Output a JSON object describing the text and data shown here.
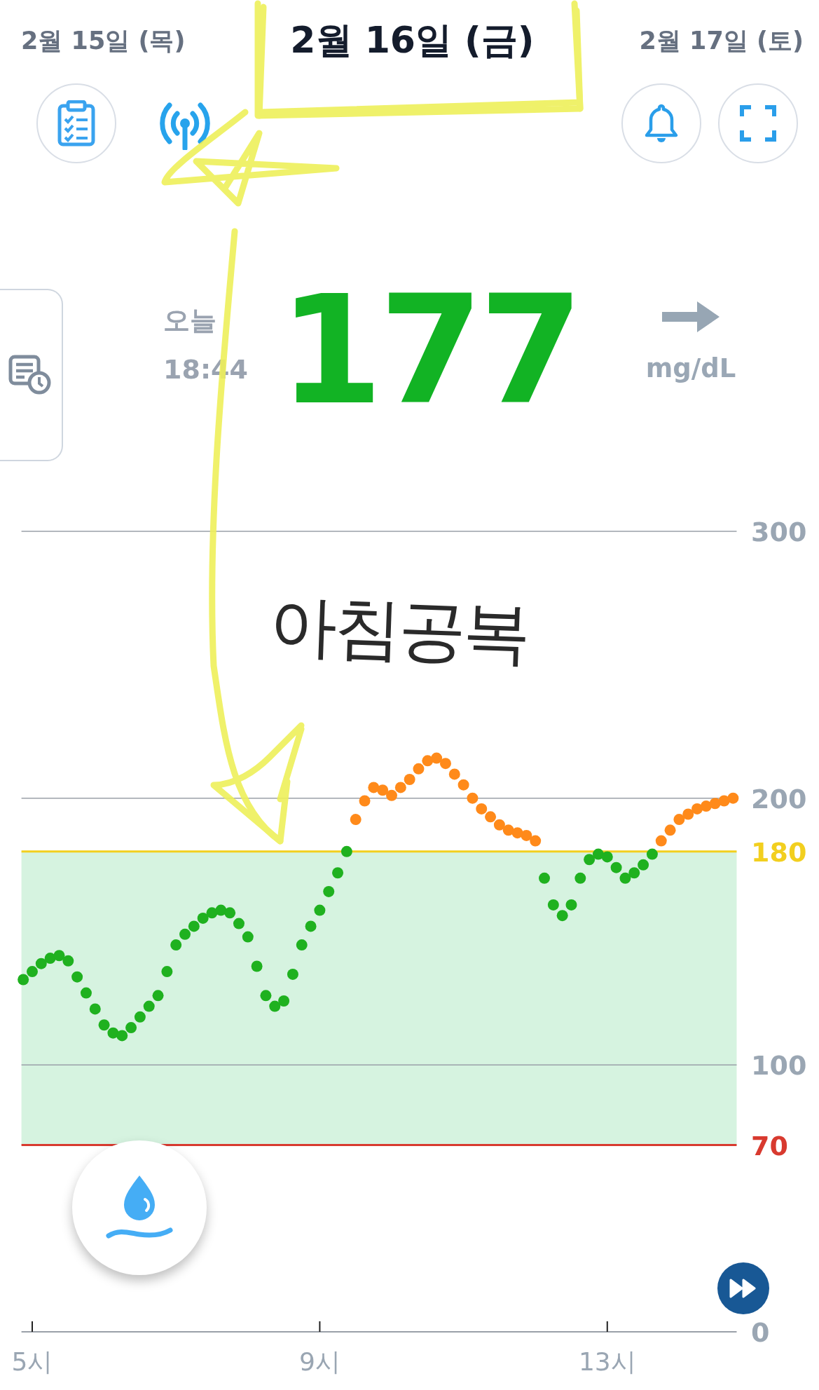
{
  "header": {
    "prev_date": "2월 15일 (목)",
    "current_date": "2월 16일 (금)",
    "next_date": "2월 17일 (토)"
  },
  "reading": {
    "day": "오늘",
    "time": "18:44",
    "value": "177",
    "unit": "mg/dL"
  },
  "handwritten_note": "아침공복",
  "chart": {
    "chart_data": {
      "type": "scatter",
      "xlim": [
        4.85,
        14.8
      ],
      "ylim": [
        0,
        300
      ],
      "xticks": [
        {
          "value": 5,
          "label": "5시"
        },
        {
          "value": 9,
          "label": "9시"
        },
        {
          "value": 13,
          "label": "13시"
        }
      ],
      "yticks": [
        0,
        100,
        200,
        300
      ],
      "x": [
        4.875,
        5,
        5.125,
        5.25,
        5.375,
        5.5,
        5.625,
        5.75,
        5.875,
        6,
        6.125,
        6.25,
        6.375,
        6.5,
        6.625,
        6.75,
        6.875,
        7,
        7.125,
        7.25,
        7.375,
        7.5,
        7.625,
        7.75,
        7.875,
        8,
        8.125,
        8.25,
        8.375,
        8.5,
        8.625,
        8.75,
        8.875,
        9,
        9.125,
        9.25,
        9.375,
        9.5,
        9.625,
        9.75,
        9.875,
        10,
        10.125,
        10.25,
        10.375,
        10.5,
        10.625,
        10.75,
        10.875,
        11,
        11.125,
        11.25,
        11.375,
        11.5,
        11.625,
        11.75,
        11.875,
        12,
        12.125,
        12.25,
        12.375,
        12.5,
        12.625,
        12.75,
        12.875,
        13,
        13.125,
        13.25,
        13.375,
        13.5,
        13.625,
        13.75,
        13.875,
        14,
        14.125,
        14.25,
        14.375,
        14.5,
        14.625,
        14.75
      ],
      "series": [
        {
          "color": "#1fb11f",
          "values": [
            132,
            135,
            138,
            140,
            141,
            139,
            133,
            127,
            121,
            115,
            112,
            111,
            114,
            118,
            122,
            126,
            135,
            145,
            149,
            152,
            155,
            157,
            158,
            157,
            153,
            148,
            137,
            126,
            122,
            124,
            134,
            145,
            152,
            158,
            165,
            172,
            180,
            null,
            null,
            null,
            null,
            null,
            null,
            null,
            null,
            null,
            null,
            null,
            null,
            null,
            null,
            null,
            null,
            null,
            null,
            null,
            null,
            null,
            170,
            160,
            156,
            160,
            170,
            177,
            179,
            178,
            174,
            170,
            172,
            175,
            179,
            null,
            null,
            null,
            null,
            null,
            null,
            null,
            null,
            null
          ]
        },
        {
          "color": "#ff8a1a",
          "values": [
            null,
            null,
            null,
            null,
            null,
            null,
            null,
            null,
            null,
            null,
            null,
            null,
            null,
            null,
            null,
            null,
            null,
            null,
            null,
            null,
            null,
            null,
            null,
            null,
            null,
            null,
            null,
            null,
            null,
            null,
            null,
            null,
            null,
            null,
            null,
            null,
            null,
            192,
            199,
            204,
            203,
            201,
            204,
            207,
            211,
            214,
            215,
            213,
            209,
            205,
            200,
            196,
            193,
            190,
            188,
            187,
            186,
            184,
            null,
            null,
            null,
            null,
            null,
            null,
            null,
            null,
            null,
            null,
            null,
            null,
            null,
            184,
            188,
            192,
            194,
            196,
            197,
            198,
            199,
            200
          ]
        }
      ],
      "bands": [
        {
          "axis": "y",
          "from": 70,
          "to": 180,
          "color": "#d6f3e0"
        }
      ],
      "ref_lines": [
        {
          "axis": "y",
          "value": 180,
          "label": "180",
          "color": "#f2cf1f"
        },
        {
          "axis": "y",
          "value": 70,
          "label": "70",
          "color": "#d83a2f"
        }
      ]
    }
  }
}
